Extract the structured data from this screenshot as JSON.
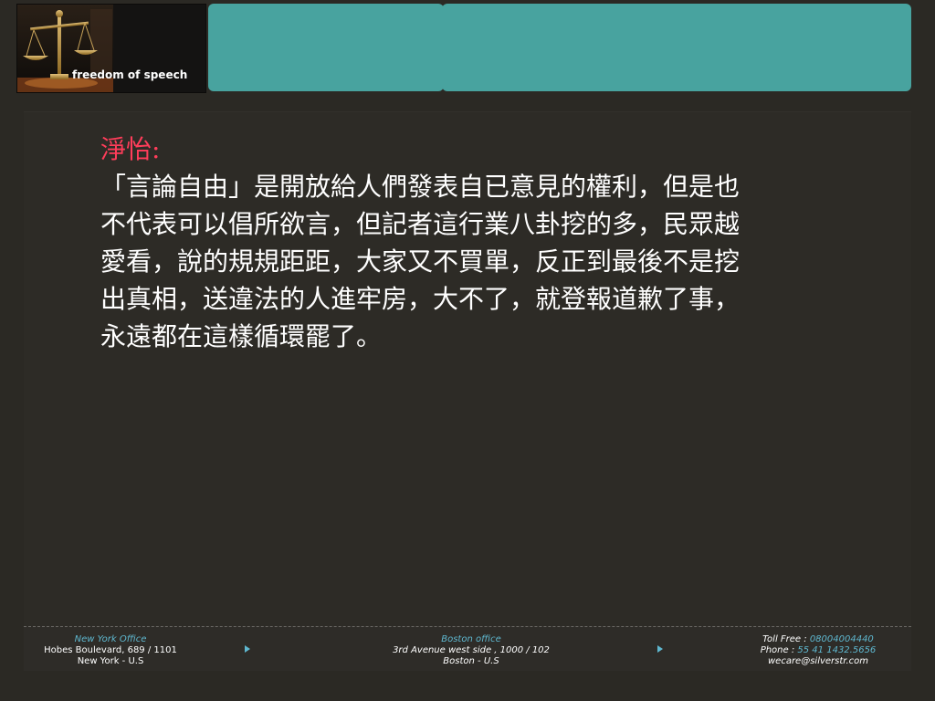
{
  "logo": {
    "text": "freedom of speech",
    "icon": "scales-of-justice-icon"
  },
  "content": {
    "speaker": "淨怡:",
    "paragraph": "「言論自由」是開放給人們發表自已意見的權利，但是也\n不代表可以倡所欲言，但記者這行業八卦挖的多，民眾越\n愛看，說的規規距距，大家又不買單，反正到最後不是挖\n出真相，送違法的人進牢房，大不了，就登報道歉了事，\n永遠都在這樣循環罷了。"
  },
  "footer": {
    "new_york": {
      "title": "New York Office",
      "line1": "Hobes Boulevard, 689 / 1101",
      "line2": "New York - U.S"
    },
    "boston": {
      "title": "Boston office",
      "line1": "3rd Avenue west side , 1000 / 102",
      "line2": "Boston - U.S"
    },
    "contact": {
      "toll_label": "Toll Free :",
      "toll_value": "08004004440",
      "phone_label": "Phone :",
      "phone_value": "55 41 1432.5656",
      "email": "wecare@silverstr.com"
    }
  },
  "colors": {
    "background": "#2b2924",
    "teal": "#48a39f",
    "speaker": "#ff3d5a",
    "accent": "#5fb8d0"
  }
}
